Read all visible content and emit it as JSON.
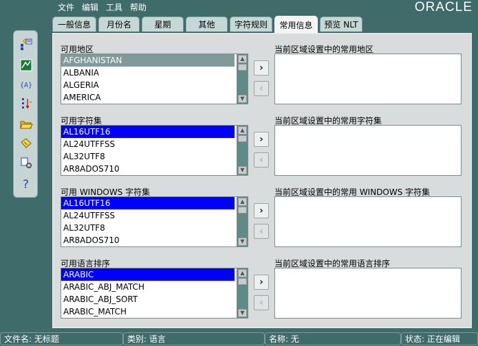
{
  "app": {
    "menu": [
      "文件",
      "编辑",
      "工具",
      "帮助"
    ],
    "logo": "ORACLE"
  },
  "tabs": [
    {
      "label": "一般信息",
      "active": false
    },
    {
      "label": "月份名",
      "active": false
    },
    {
      "label": "星期",
      "active": false
    },
    {
      "label": "其他",
      "active": false
    },
    {
      "label": "字符规则",
      "active": false
    },
    {
      "label": "常用信息",
      "active": true
    },
    {
      "label": "预览 NLT",
      "active": false
    }
  ],
  "toolbar": {
    "icons": [
      "properties-icon",
      "map-icon",
      "variable-icon",
      "sort-icon",
      "open-folder-icon",
      "edit-document-icon",
      "settings-icon",
      "help-icon"
    ]
  },
  "sections": [
    {
      "label": "可用地区",
      "target_label": "当前区域设置中的常用地区",
      "selection_style": "grey",
      "items": [
        "AFGHANISTAN",
        "ALBANIA",
        "ALGERIA",
        "AMERICA"
      ]
    },
    {
      "label": "可用字符集",
      "target_label": "当前区域设置中的常用字符集",
      "selection_style": "blue",
      "items": [
        "AL16UTF16",
        "AL24UTFFSS",
        "AL32UTF8",
        "AR8ADOS710"
      ]
    },
    {
      "label": "可用 WINDOWS 字符集",
      "target_label": "当前区域设置中的常用 WINDOWS 字符集",
      "selection_style": "blue",
      "items": [
        "AL16UTF16",
        "AL24UTFFSS",
        "AL32UTF8",
        "AR8ADOS710"
      ]
    },
    {
      "label": "可用语言排序",
      "target_label": "当前区域设置中的常用语言排序",
      "selection_style": "blue",
      "items": [
        "ARABIC",
        "ARABIC_ABJ_MATCH",
        "ARABIC_ABJ_SORT",
        "ARABIC_MATCH"
      ]
    }
  ],
  "buttons": {
    "add": "›",
    "remove": "‹"
  },
  "status": {
    "file": "文件名: 无标题",
    "category": "类别: 语言",
    "name": "名称: 无",
    "state": "状态: 正在编辑"
  },
  "colors": {
    "background": "#3f6b6b",
    "selection_blue": "#0000ff",
    "selection_grey": "#7f9a98",
    "panel": "#d9dcdc"
  }
}
